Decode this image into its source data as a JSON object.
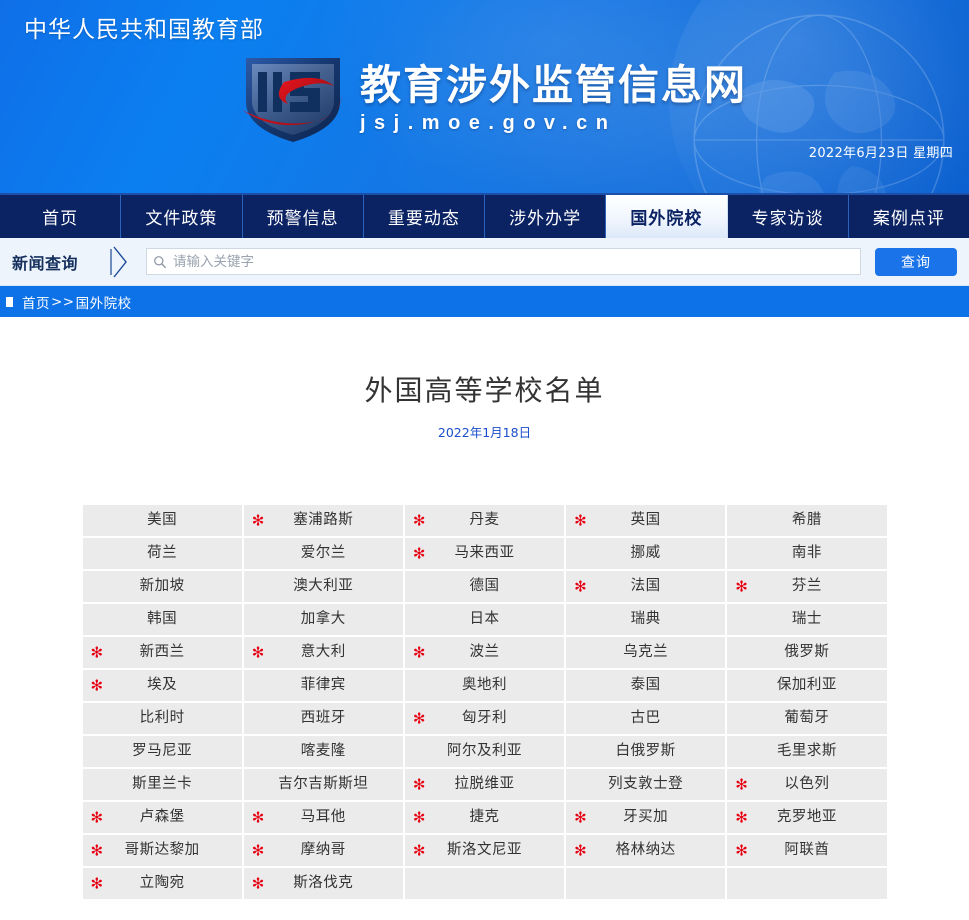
{
  "header": {
    "ministry": "中华人民共和国教育部",
    "logo_title": "教育涉外监管信息网",
    "logo_domain": "jsj.moe.gov.cn",
    "date": "2022年6月23日  星期四"
  },
  "nav": {
    "items": [
      {
        "label": "首页",
        "active": false
      },
      {
        "label": "文件政策",
        "active": false
      },
      {
        "label": "预警信息",
        "active": false
      },
      {
        "label": "重要动态",
        "active": false
      },
      {
        "label": "涉外办学",
        "active": false
      },
      {
        "label": "国外院校",
        "active": true
      },
      {
        "label": "专家访谈",
        "active": false
      },
      {
        "label": "案例点评",
        "active": false
      }
    ]
  },
  "search": {
    "label": "新闻查询",
    "placeholder": "请输入关键字",
    "value": "",
    "button_label": "查询"
  },
  "breadcrumb": {
    "home": "首页",
    "separator": ">>",
    "current": "国外院校"
  },
  "main": {
    "title": "外国高等学校名单",
    "date": "2022年1月18日"
  },
  "table": {
    "star_symbol": "✻",
    "rows": [
      [
        {
          "name": "美国",
          "star": false
        },
        {
          "name": "塞浦路斯",
          "star": true
        },
        {
          "name": "丹麦",
          "star": true
        },
        {
          "name": "英国",
          "star": true
        },
        {
          "name": "希腊",
          "star": false
        }
      ],
      [
        {
          "name": "荷兰",
          "star": false
        },
        {
          "name": "爱尔兰",
          "star": false
        },
        {
          "name": "马来西亚",
          "star": true
        },
        {
          "name": "挪威",
          "star": false
        },
        {
          "name": "南非",
          "star": false
        }
      ],
      [
        {
          "name": "新加坡",
          "star": false
        },
        {
          "name": "澳大利亚",
          "star": false
        },
        {
          "name": "德国",
          "star": false
        },
        {
          "name": "法国",
          "star": true
        },
        {
          "name": "芬兰",
          "star": true
        }
      ],
      [
        {
          "name": "韩国",
          "star": false
        },
        {
          "name": "加拿大",
          "star": false
        },
        {
          "name": "日本",
          "star": false
        },
        {
          "name": "瑞典",
          "star": false
        },
        {
          "name": "瑞士",
          "star": false
        }
      ],
      [
        {
          "name": "新西兰",
          "star": true
        },
        {
          "name": "意大利",
          "star": true
        },
        {
          "name": "波兰",
          "star": true
        },
        {
          "name": "乌克兰",
          "star": false
        },
        {
          "name": "俄罗斯",
          "star": false
        }
      ],
      [
        {
          "name": "埃及",
          "star": true
        },
        {
          "name": "菲律宾",
          "star": false
        },
        {
          "name": "奥地利",
          "star": false
        },
        {
          "name": "泰国",
          "star": false
        },
        {
          "name": "保加利亚",
          "star": false
        }
      ],
      [
        {
          "name": "比利时",
          "star": false
        },
        {
          "name": "西班牙",
          "star": false
        },
        {
          "name": "匈牙利",
          "star": true
        },
        {
          "name": "古巴",
          "star": false
        },
        {
          "name": "葡萄牙",
          "star": false
        }
      ],
      [
        {
          "name": "罗马尼亚",
          "star": false
        },
        {
          "name": "喀麦隆",
          "star": false
        },
        {
          "name": "阿尔及利亚",
          "star": false
        },
        {
          "name": "白俄罗斯",
          "star": false
        },
        {
          "name": "毛里求斯",
          "star": false
        }
      ],
      [
        {
          "name": "斯里兰卡",
          "star": false
        },
        {
          "name": "吉尔吉斯斯坦",
          "star": false
        },
        {
          "name": "拉脱维亚",
          "star": true
        },
        {
          "name": "列支敦士登",
          "star": false
        },
        {
          "name": "以色列",
          "star": true
        }
      ],
      [
        {
          "name": "卢森堡",
          "star": true
        },
        {
          "name": "马耳他",
          "star": true
        },
        {
          "name": "捷克",
          "star": true
        },
        {
          "name": "牙买加",
          "star": true
        },
        {
          "name": "克罗地亚",
          "star": true
        }
      ],
      [
        {
          "name": "哥斯达黎加",
          "star": true
        },
        {
          "name": "摩纳哥",
          "star": true
        },
        {
          "name": "斯洛文尼亚",
          "star": true
        },
        {
          "name": "格林纳达",
          "star": true
        },
        {
          "name": "阿联酋",
          "star": true
        }
      ],
      [
        {
          "name": "立陶宛",
          "star": true
        },
        {
          "name": "斯洛伐克",
          "star": true
        },
        {
          "name": "",
          "star": false
        },
        {
          "name": "",
          "star": false
        },
        {
          "name": "",
          "star": false
        }
      ]
    ]
  }
}
